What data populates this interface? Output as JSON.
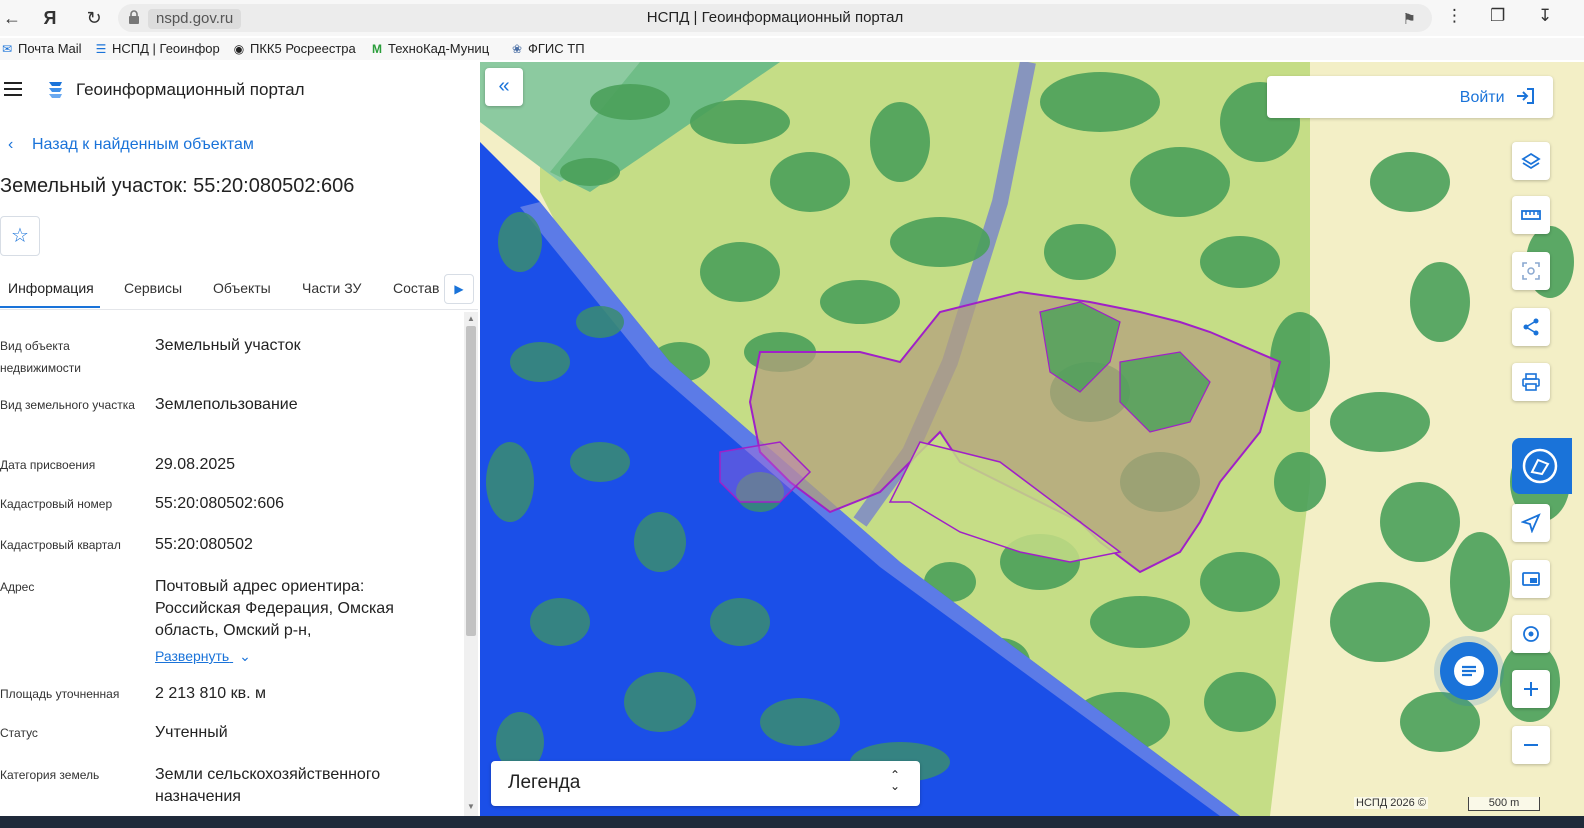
{
  "browser": {
    "url": "nspd.gov.ru",
    "page_title": "НСПД | Геоинформационный портал",
    "bookmarks": [
      "Почта Mail",
      "НСПД | Геоинфор",
      "ПКК5 Росреестра",
      "ТехноКад-Муниц",
      "ФГИС ТП"
    ]
  },
  "panel": {
    "portal_title": "Геоинформационный портал",
    "back_link": "Назад к найденным объектам",
    "object_title": "Земельный участок: 55:20:080502:606",
    "tabs": [
      "Информация",
      "Сервисы",
      "Объекты",
      "Части ЗУ",
      "Состав"
    ],
    "active_tab": "Информация",
    "rows": [
      {
        "label": "Вид объекта недвижимости",
        "value": "Земельный участок"
      },
      {
        "label": "Вид земельного участка",
        "value": "Землепользование"
      },
      {
        "label": "Дата присвоения",
        "value": "29.08.2025"
      },
      {
        "label": "Кадастровый номер",
        "value": "55:20:080502:606"
      },
      {
        "label": "Кадастровый квартал",
        "value": "55:20:080502"
      },
      {
        "label": "Адрес",
        "value": "Почтовый адрес ориентира: Российская Федерация, Омская область, Омский р-н,"
      },
      {
        "label": "Площадь уточненная",
        "value": "2 213 810 кв. м"
      },
      {
        "label": "Статус",
        "value": "Учтенный"
      },
      {
        "label": "Категория земель",
        "value": "Земли сельскохозяйственного назначения"
      }
    ],
    "expand_link": "Развернуть"
  },
  "map": {
    "login_label": "Войти",
    "legend_label": "Легенда",
    "copyright": "НСПД 2026 ©",
    "scale_label": "500 m",
    "tools": [
      "layers-icon",
      "ruler-icon",
      "select-area-icon",
      "share-icon",
      "print-icon",
      "assistant-icon",
      "locate-icon",
      "minimap-icon",
      "geolocation-icon",
      "zoom-in-icon",
      "zoom-out-icon"
    ],
    "colors": {
      "water": "#1b4fe8",
      "forest": "#4aa05a",
      "meadow": "#c5dd86",
      "parcel_border": "#a020c8",
      "accent": "#1a73d9"
    }
  }
}
